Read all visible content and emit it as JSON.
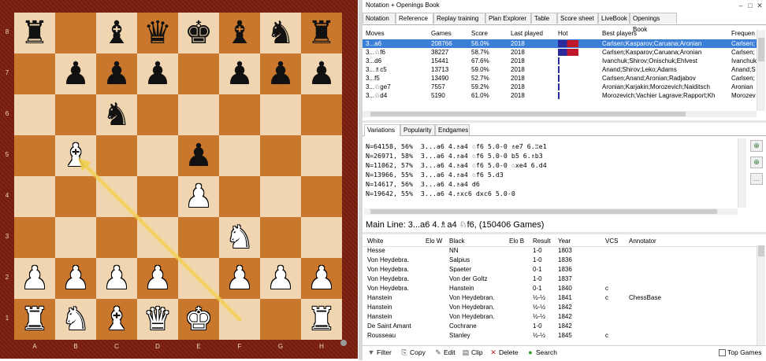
{
  "board": {
    "ranks": [
      "8",
      "7",
      "6",
      "5",
      "4",
      "3",
      "2",
      "1"
    ],
    "files": [
      "A",
      "B",
      "C",
      "D",
      "E",
      "F",
      "G",
      "H"
    ],
    "pieces": [
      [
        "br",
        "",
        "bb",
        "bq",
        "bk",
        "bb",
        "bn",
        "br"
      ],
      [
        "",
        "bp",
        "bp",
        "bp",
        "",
        "bp",
        "bp",
        "bp"
      ],
      [
        "",
        "",
        "bn",
        "",
        "",
        "",
        "",
        ""
      ],
      [
        "",
        "wb",
        "",
        "",
        "bp",
        "",
        "",
        ""
      ],
      [
        "",
        "",
        "",
        "",
        "wp",
        "",
        "",
        ""
      ],
      [
        "",
        "",
        "",
        "",
        "",
        "wn",
        "",
        ""
      ],
      [
        "wp",
        "wp",
        "wp",
        "wp",
        "",
        "wp",
        "wp",
        "wp"
      ],
      [
        "wr",
        "wn",
        "wb",
        "wq",
        "wk",
        "",
        "",
        "wr"
      ]
    ],
    "arrow_from": "f1",
    "arrow_to": "b5",
    "arrow_color": "#f2d04a"
  },
  "window": {
    "title": "Notation + Openings Book",
    "min": "–",
    "max": "□",
    "close": "✕"
  },
  "tabs": [
    "Notation",
    "Reference",
    "Replay training",
    "Plan Explorer",
    "Table",
    "Score sheet",
    "LiveBook",
    "Openings Book"
  ],
  "active_tab": 1,
  "reference": {
    "headers": [
      "Moves",
      "Games",
      "Score",
      "Last played",
      "Hot",
      "Best players",
      "Frequen"
    ],
    "rows": [
      {
        "move": "3...a6",
        "games": "208766",
        "score": "56.0%",
        "last": "2018",
        "hot": "full",
        "players": "Carlsen;Kasparov;Caruana;Aronian",
        "freq": "Carlsen;"
      },
      {
        "move": "3...♘f6",
        "games": "38227",
        "score": "58.7%",
        "last": "2018",
        "hot": "full",
        "players": "Carlsen;Kasparov;Caruana;Aronian",
        "freq": "Carlsen;"
      },
      {
        "move": "3...d6",
        "games": "15441",
        "score": "67.6%",
        "last": "2018",
        "hot": "line",
        "players": "Ivanchuk;Shirov;Onischuk;Ehlvest",
        "freq": "Ivanchuk"
      },
      {
        "move": "3...♗c5",
        "games": "13713",
        "score": "59.0%",
        "last": "2018",
        "hot": "line",
        "players": "Anand;Shirov;Leko;Adams",
        "freq": "Anand;S"
      },
      {
        "move": "3...f5",
        "games": "13490",
        "score": "52.7%",
        "last": "2018",
        "hot": "line",
        "players": "Carlsen;Anand;Aronian;Radjabov",
        "freq": "Carlsen;"
      },
      {
        "move": "3...♘ge7",
        "games": "7557",
        "score": "59.2%",
        "last": "2018",
        "hot": "line",
        "players": "Aronian;Karjakin;Morozevich;Naiditsch",
        "freq": "Aronian"
      },
      {
        "move": "3...♘d4",
        "games": "5190",
        "score": "61.0%",
        "last": "2018",
        "hot": "line",
        "players": "Morozevich;Vachier Lagrave;Rapport;Kh",
        "freq": "Morozev"
      }
    ]
  },
  "sub_tabs": [
    "Variations",
    "Popularity",
    "Endgames"
  ],
  "variations": [
    "N=64158, 56%  3...a6 4.♗a4 ♘f6 5.0-0 ♗e7 6.♖e1",
    "N=26971, 58%  3...a6 4.♗a4 ♘f6 5.0-0 b5 6.♗b3",
    "N=11062, 57%  3...a6 4.♗a4 ♘f6 5.0-0 ♘xe4 6.d4",
    "N=13966, 55%  3...a6 4.♗a4 ♘f6 5.d3",
    "N=14617, 56%  3...a6 4.♗a4 d6",
    "N=19642, 55%  3...a6 4.♗xc6 dxc6 5.0-0"
  ],
  "side_buttons": [
    "⊕",
    "⊕",
    "…"
  ],
  "main_line": "Main Line: 3...a6 4.♗a4 ♘f6, (150406 Games)",
  "games": {
    "headers": [
      "White",
      "Elo W",
      "Black",
      "Elo B",
      "Result",
      "Year",
      "VCS",
      "Annotator"
    ],
    "rows": [
      {
        "white": "Hesse",
        "black": "NN",
        "result": "1-0",
        "year": "1803",
        "vcs": "",
        "ann": ""
      },
      {
        "white": "Von Heydebra.",
        "black": "Salpius",
        "result": "1-0",
        "year": "1836",
        "vcs": "",
        "ann": ""
      },
      {
        "white": "Von Heydebra.",
        "black": "Spaeter",
        "result": "0-1",
        "year": "1836",
        "vcs": "",
        "ann": ""
      },
      {
        "white": "Von Heydebra.",
        "black": "Von der Goltz",
        "result": "1-0",
        "year": "1837",
        "vcs": "",
        "ann": ""
      },
      {
        "white": "Von Heydebra.",
        "black": "Hanstein",
        "result": "0-1",
        "year": "1840",
        "vcs": "c",
        "ann": ""
      },
      {
        "white": "Hanstein",
        "black": "Von Heydebran.",
        "result": "½-½",
        "year": "1841",
        "vcs": "c",
        "ann": "ChessBase"
      },
      {
        "white": "Hanstein",
        "black": "Von Heydebran.",
        "result": "½-½",
        "year": "1842",
        "vcs": "",
        "ann": ""
      },
      {
        "white": "Hanstein",
        "black": "Von Heydebran.",
        "result": "½-½",
        "year": "1842",
        "vcs": "",
        "ann": ""
      },
      {
        "white": "De Saint Amant",
        "black": "Cochrane",
        "result": "1-0",
        "year": "1842",
        "vcs": "",
        "ann": ""
      },
      {
        "white": "Rousseau",
        "black": "Stanley",
        "result": "½-½",
        "year": "1845",
        "vcs": "c",
        "ann": ""
      }
    ]
  },
  "toolbar": {
    "filter": "Filter",
    "copy": "Copy",
    "edit": "Edit",
    "clip": "Clip",
    "delete": "Delete",
    "search": "Search",
    "top_games": "Top Games"
  },
  "colors": {
    "selection": "#3c7fd6",
    "hot_full": "#2a2a9a",
    "hot_accent": "#c0182a",
    "board_dark": "#c8772d",
    "board_light": "#efd6b0",
    "frame": "#7a1d0e"
  }
}
